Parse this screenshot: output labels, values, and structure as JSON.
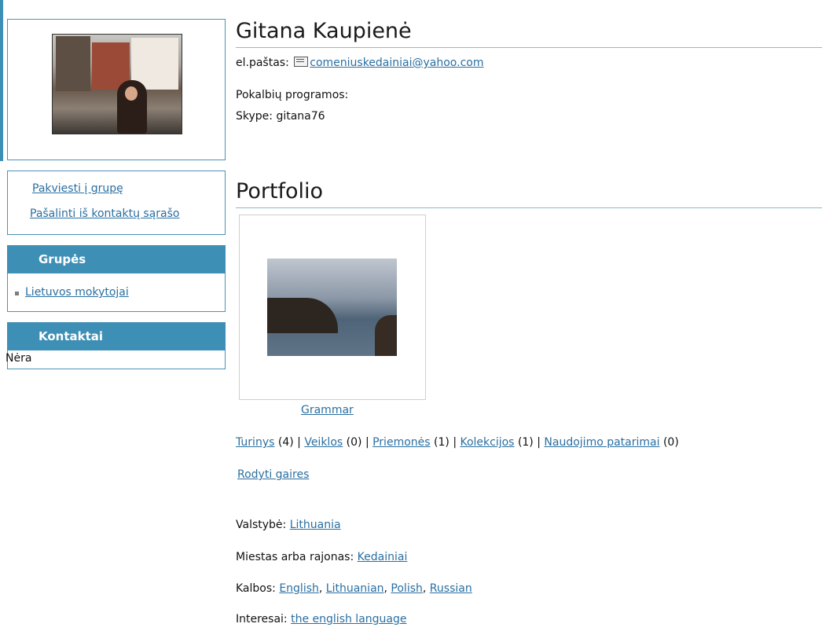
{
  "profile": {
    "name": "Gitana Kaupienė",
    "email_label": "el.paštas:",
    "email": "comeniuskedainiai@yahoo.com",
    "im_label": "Pokalbių programos:",
    "skype_label": "Skype:",
    "skype": "gitana76",
    "photo_icon": "profile-photo"
  },
  "sidebar": {
    "actions": {
      "invite": "Pakviesti į grupę",
      "remove": "Pašalinti iš kontaktų sąrašo"
    },
    "groups": {
      "title": "Grupės",
      "items": [
        "Lietuvos mokytojai"
      ]
    },
    "contacts": {
      "title": "Kontaktai",
      "empty": "Nėra"
    }
  },
  "portfolio": {
    "title": "Portfolio",
    "item": {
      "caption": "Grammar"
    },
    "stats": [
      {
        "label": "Turinys",
        "count": "(4)"
      },
      {
        "label": "Veiklos",
        "count": "(0)"
      },
      {
        "label": "Priemonės",
        "count": "(1)"
      },
      {
        "label": "Kolekcijos",
        "count": "(1)"
      },
      {
        "label": "Naudojimo patarimai",
        "count": "(0)"
      }
    ],
    "separator": "|",
    "show_guides": "Rodyti gaires"
  },
  "details": {
    "country_label": "Valstybė:",
    "country": "Lithuania",
    "city_label": "Miestas arba rajonas:",
    "city": "Kedainiai",
    "languages_label": "Kalbos:",
    "languages": [
      "English",
      "Lithuanian",
      "Polish",
      "Russian"
    ],
    "interests_label": "Interesai:",
    "interests": "the english language"
  },
  "colors": {
    "accent": "#3e8fb5",
    "link": "#2a6fa1",
    "border": "#4a93b6"
  }
}
